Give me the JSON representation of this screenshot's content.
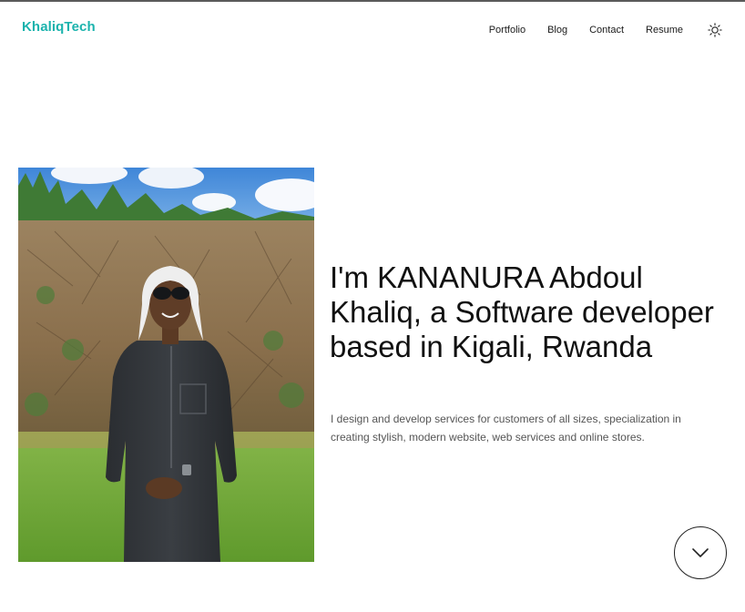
{
  "header": {
    "logo_text": "KhaliqTech",
    "nav": [
      {
        "label": "Portfolio"
      },
      {
        "label": "Blog"
      },
      {
        "label": "Contact"
      },
      {
        "label": "Resume"
      }
    ],
    "theme_toggle_icon": "sun-icon"
  },
  "hero": {
    "headline": "I'm KANANURA Abdoul Khaliq, a Software developer based in Kigali, Rwanda",
    "description": "I design and develop services for customers of all sizes, specialization in creating stylish, modern website, web services and online stores.",
    "photo_icon": "portrait-photo",
    "scroll_icon": "chevron-down-icon"
  },
  "colors": {
    "brand": "#1bb3ad",
    "text": "#111111",
    "muted": "#555555"
  }
}
